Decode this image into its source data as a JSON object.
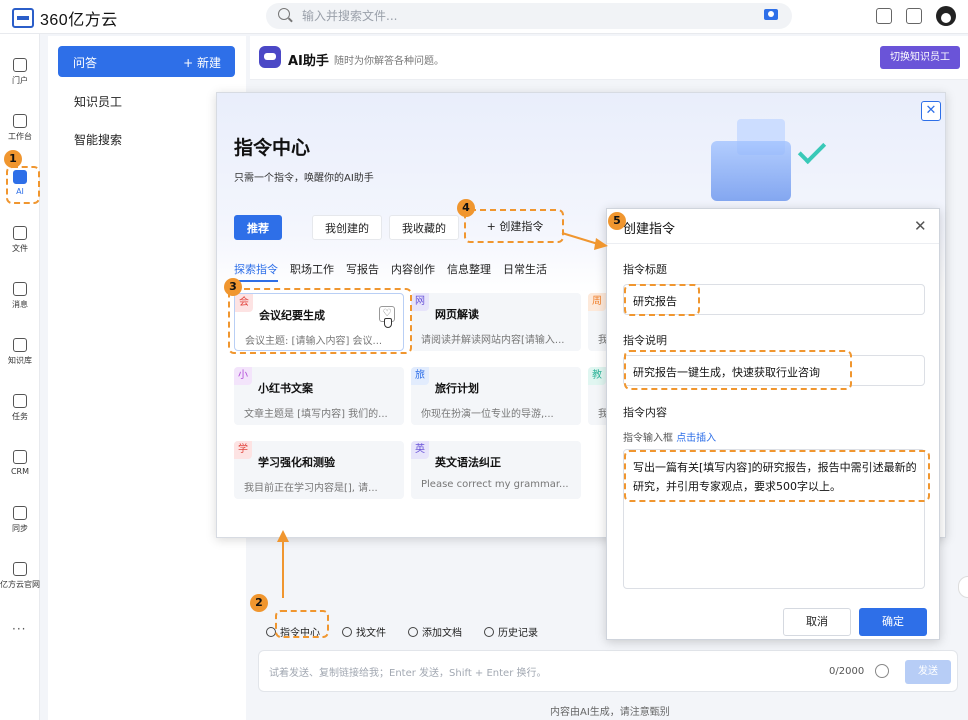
{
  "app": {
    "logo_text": "360亿方云"
  },
  "search": {
    "placeholder": "输入并搜索文件..."
  },
  "rail": [
    {
      "label": "门户",
      "icon": "home-icon"
    },
    {
      "label": "工作台",
      "icon": "grid-icon"
    },
    {
      "label": "AI",
      "icon": "ai-icon"
    },
    {
      "label": "文件",
      "icon": "folder-icon"
    },
    {
      "label": "消息",
      "icon": "message-icon"
    },
    {
      "label": "知识库",
      "icon": "book-icon"
    },
    {
      "label": "任务",
      "icon": "task-icon"
    },
    {
      "label": "CRM",
      "icon": "crm-icon"
    },
    {
      "label": "同步",
      "icon": "sync-icon"
    },
    {
      "label": "亿方云官网",
      "icon": "cloud-icon"
    }
  ],
  "rail_more": "···",
  "subnav": {
    "active_label": "问答",
    "new_label": "+ 新建",
    "items": [
      "知识员工",
      "智能搜索"
    ]
  },
  "ai_header": {
    "title": "AI助手",
    "subtitle": "随时为你解答各种问题。",
    "switch_label": "切换知识员工"
  },
  "cmd": {
    "title": "指令中心",
    "subtitle": "只需一个指令，唤醒你的AI助手",
    "close": "✕",
    "tabs": [
      "推荐",
      "我创建的",
      "我收藏的"
    ],
    "create_label": "+  创建指令",
    "categories": [
      "探索指令",
      "职场工作",
      "写报告",
      "内容创作",
      "信息整理",
      "日常生活"
    ],
    "cards": [
      {
        "tag": "会",
        "tag_bg": "#fde3e3",
        "tag_color": "#e2463f",
        "title": "会议纪要生成",
        "desc": "会议主题: [请输入内容] 会议..."
      },
      {
        "tag": "网",
        "tag_bg": "#e7e4fb",
        "tag_color": "#6a54d8",
        "title": "网页解读",
        "desc": "请阅读并解读网站内容[请输入..."
      },
      {
        "tag": "周",
        "tag_bg": "#fde9da",
        "tag_color": "#f0822f",
        "title": "",
        "desc": "我"
      },
      {
        "tag": "小",
        "tag_bg": "#f3e4fb",
        "tag_color": "#b14ad8",
        "title": "小红书文案",
        "desc": "文章主题是 [填写内容] 我们的..."
      },
      {
        "tag": "旅",
        "tag_bg": "#e2ecfd",
        "tag_color": "#2e6fe8",
        "title": "旅行计划",
        "desc": "你现在扮演一位专业的导游,..."
      },
      {
        "tag": "教",
        "tag_bg": "#e0f6f1",
        "tag_color": "#2fb59a",
        "title": "",
        "desc": "我"
      },
      {
        "tag": "学",
        "tag_bg": "#fde3e3",
        "tag_color": "#e2463f",
        "title": "学习强化和测验",
        "desc": "我目前正在学习内容是[], 请..."
      },
      {
        "tag": "英",
        "tag_bg": "#e7e4fb",
        "tag_color": "#6a54d8",
        "title": "英文语法纠正",
        "desc": "Please correct my grammar..."
      }
    ]
  },
  "create": {
    "title": "创建指令",
    "close": "✕",
    "title_label": "指令标题",
    "title_value": "研究报告",
    "desc_label": "指令说明",
    "desc_value": "研究报告一键生成，快速获取行业咨询",
    "content_label": "指令内容",
    "hint_prefix": "指令输入框",
    "hint_link": "点击插入",
    "content_value": "写出一篇有关[填写内容]的研究报告，报告中需引述最新的研究，并引用专家观点，要求500字以上。",
    "cancel": "取消",
    "ok": "确定"
  },
  "chat": {
    "tools": [
      "指令中心",
      "找文件",
      "添加文档",
      "历史记录"
    ],
    "placeholder": "试着发送、复制链接给我；Enter 发送，Shift + Enter 换行。",
    "counter": "0/2000",
    "send": "发送",
    "footer": "内容由AI生成，请注意甄别"
  },
  "annotations": [
    "1",
    "2",
    "3",
    "4",
    "5"
  ],
  "colors": {
    "accent": "#2e6fe8",
    "annotation": "#f0962f",
    "switch_button": "#6a54d8"
  }
}
